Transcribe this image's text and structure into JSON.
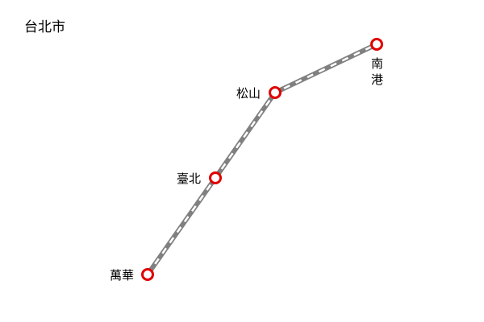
{
  "map": {
    "city_name": "台北市",
    "line_colors": {
      "rail_dark": "#808080",
      "rail_light": "#ffffff",
      "station_ring": "#e00000",
      "station_fill": "#ffffff"
    },
    "stations": [
      {
        "id": "wanhua",
        "name": "萬華"
      },
      {
        "id": "taipei",
        "name": "臺北"
      },
      {
        "id": "songshan",
        "name": "松山"
      },
      {
        "id": "nangang",
        "name_line1": "南",
        "name_line2": "港"
      }
    ]
  }
}
